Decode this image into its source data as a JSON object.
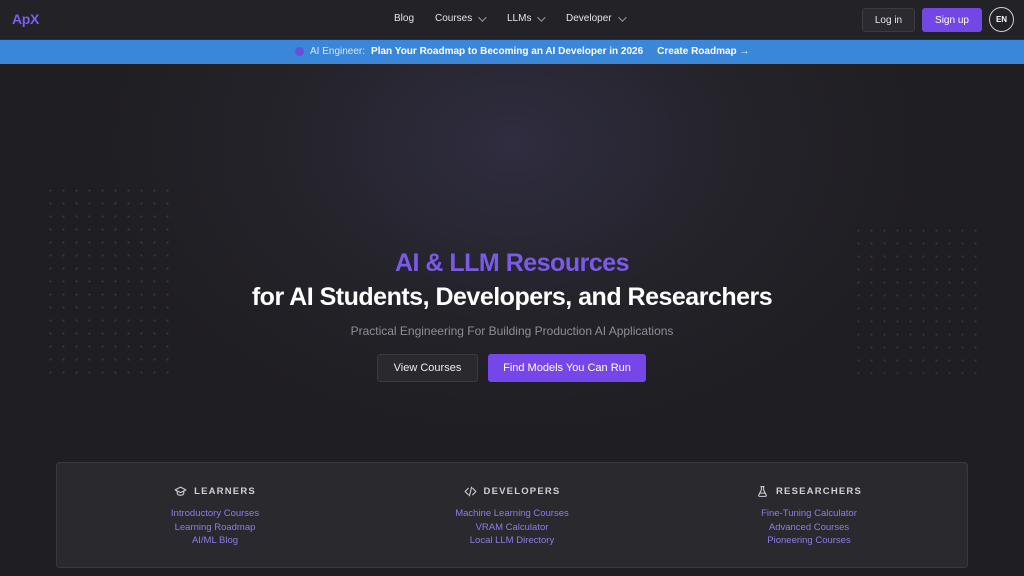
{
  "nav": {
    "logo": "ApX",
    "links": [
      {
        "label": "Blog",
        "dropdown": false
      },
      {
        "label": "Courses",
        "dropdown": true
      },
      {
        "label": "LLMs",
        "dropdown": true
      },
      {
        "label": "Developer",
        "dropdown": true
      }
    ],
    "login": "Log in",
    "signup": "Sign up",
    "lang": "EN"
  },
  "banner": {
    "tag": "AI Engineer:",
    "message": "Plan Your Roadmap to Becoming an AI Developer in 2026",
    "cta": "Create Roadmap →"
  },
  "hero": {
    "title_line1": "AI & LLM Resources",
    "title_line2": "for AI Students, Developers, and Researchers",
    "subtitle": "Practical Engineering For Building Production AI Applications",
    "btn_primary": "Find Models You Can Run",
    "btn_secondary": "View Courses"
  },
  "audiences": [
    {
      "title": "LEARNERS",
      "icon": "graduation-cap-icon",
      "links": [
        "Introductory Courses",
        "Learning Roadmap",
        "AI/ML Blog"
      ]
    },
    {
      "title": "DEVELOPERS",
      "icon": "code-icon",
      "links": [
        "Machine Learning Courses",
        "VRAM Calculator",
        "Local LLM Directory"
      ]
    },
    {
      "title": "RESEARCHERS",
      "icon": "flask-icon",
      "links": [
        "Fine-Tuning Calculator",
        "Advanced Courses",
        "Pioneering Courses"
      ]
    }
  ],
  "colors": {
    "accent": "#7346e6",
    "banner": "#3a86d8",
    "background": "#1f1e22"
  }
}
